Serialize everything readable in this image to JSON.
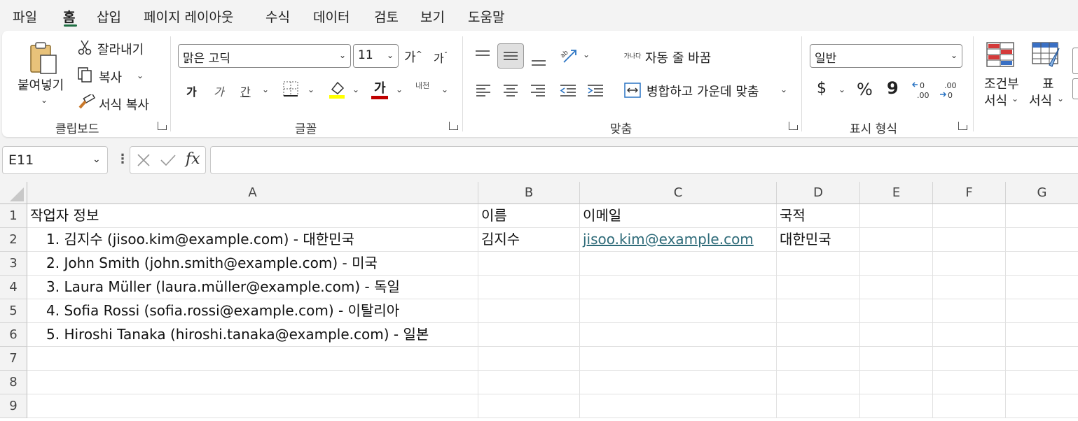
{
  "menu": {
    "tabs": [
      "파일",
      "홈",
      "삽입",
      "페이지 레이아웃",
      "수식",
      "데이터",
      "검토",
      "보기",
      "도움말"
    ],
    "active": "홈"
  },
  "ribbon": {
    "clipboard": {
      "paste": "붙여넣기",
      "cut": "잘라내기",
      "copy": "복사",
      "format_painter": "서식 복사",
      "label": "클립보드"
    },
    "font": {
      "font_name": "맑은 고딕",
      "font_size": "11",
      "grow": "가",
      "shrink": "가",
      "bold": "가",
      "italic": "가",
      "underline": "간",
      "font_color_glyph": "가",
      "phonetic": "내천",
      "label": "글꼴",
      "fill_color": "#ffff00",
      "text_color": "#c00000"
    },
    "alignment": {
      "wrap_text": "자동 줄 바꿈",
      "merge_center": "병합하고 가운데 맞춤",
      "label": "맞춤",
      "wrap_icon_text": "가나다"
    },
    "number": {
      "format": "일반",
      "currency": "$",
      "percent": "%",
      "comma": "9",
      "label": "표시 형식"
    },
    "styles": {
      "conditional": [
        "조건부",
        "서식"
      ],
      "table": [
        "표",
        "서식"
      ]
    }
  },
  "formula_bar": {
    "name_box": "E11",
    "formula": ""
  },
  "sheet": {
    "columns": [
      "A",
      "B",
      "C",
      "D",
      "E",
      "F",
      "G"
    ],
    "rows": [
      "1",
      "2",
      "3",
      "4",
      "5",
      "6",
      "7",
      "8",
      "9"
    ],
    "cells": {
      "A1": "작업자 정보",
      "B1": "이름",
      "C1": "이메일",
      "D1": "국적",
      "A2": "1. 김지수 (jisoo.kim@example.com) - 대한민국",
      "B2": "김지수",
      "C2": "jisoo.kim@example.com",
      "D2": "대한민국",
      "A3": "2. John Smith (john.smith@example.com) - 미국",
      "A4": "3. Laura Müller (laura.müller@example.com) - 독일",
      "A5": "4. Sofia Rossi (sofia.rossi@example.com) - 이탈리아",
      "A6": "5. Hiroshi Tanaka (hiroshi.tanaka@example.com) - 일본"
    }
  }
}
